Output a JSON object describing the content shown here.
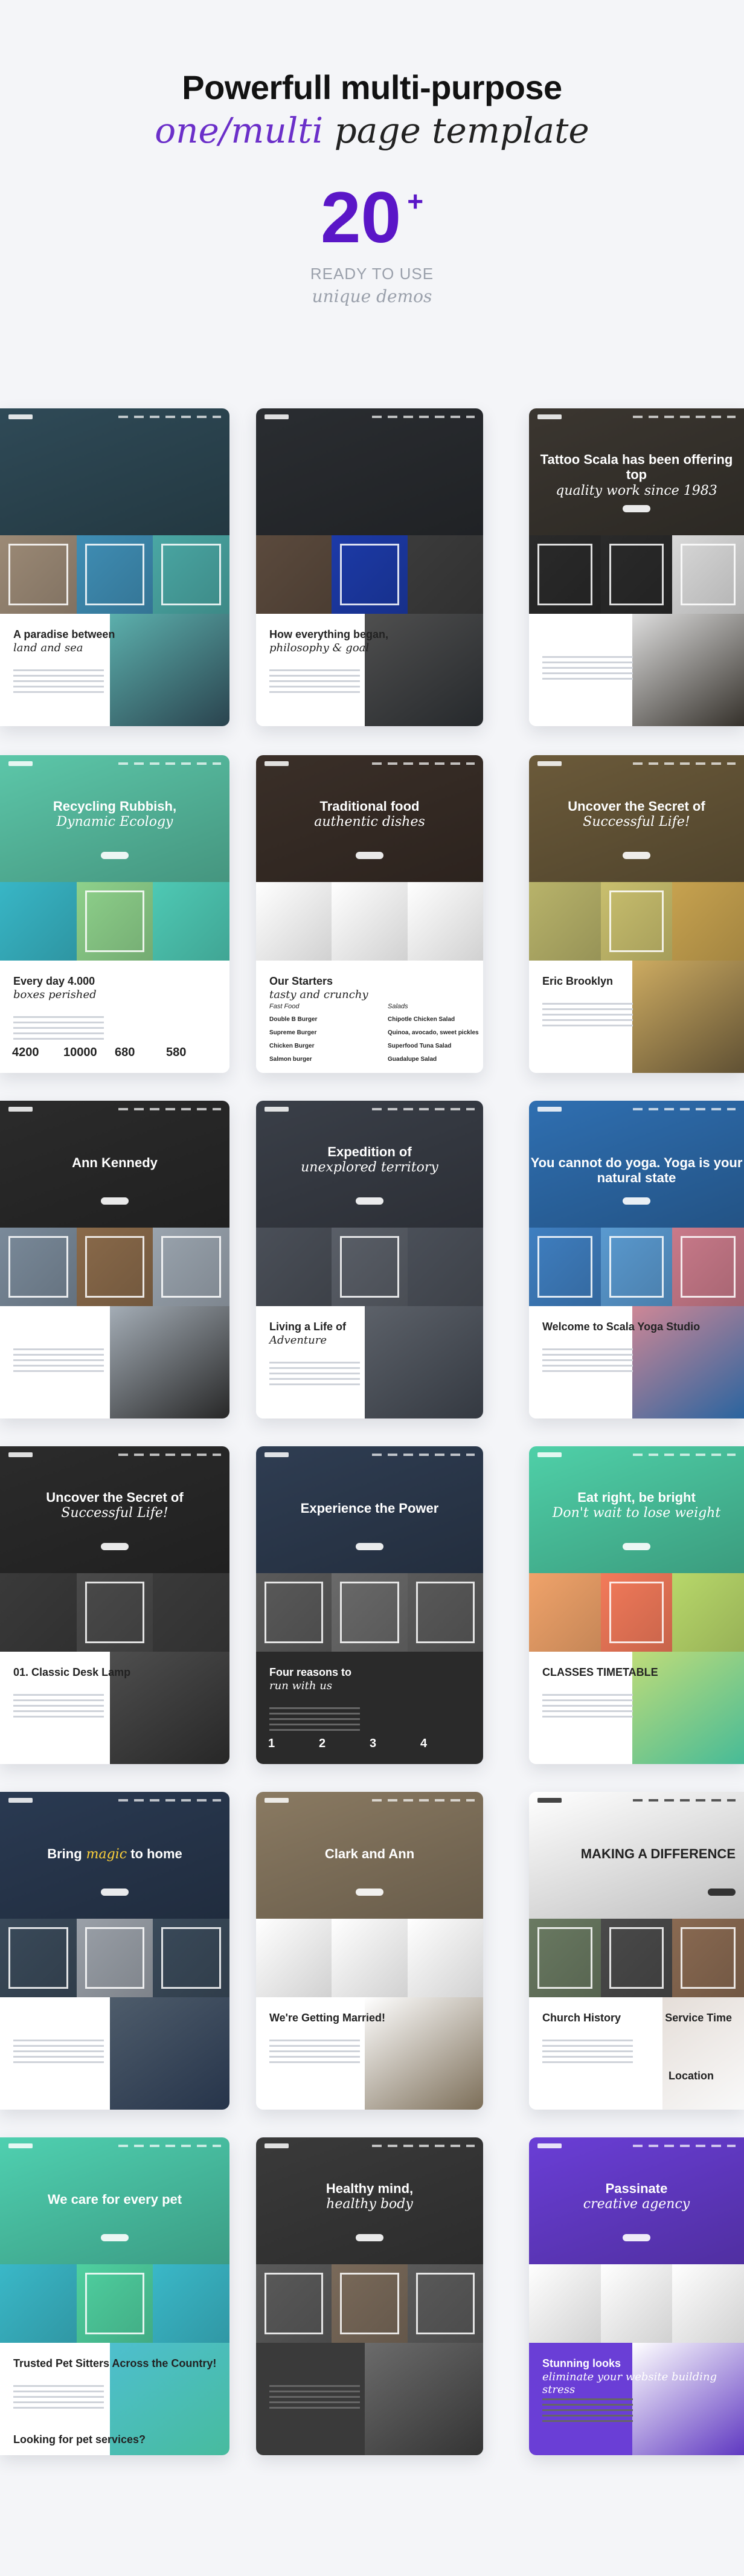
{
  "header": {
    "line1": "Powerfull multi-purpose",
    "line2_accent": "one/multi",
    "line2_rest": " page template",
    "count": "20",
    "count_plus": "+",
    "ready": "READY TO USE",
    "unique": "unique demos"
  },
  "demos": [
    {
      "title": "",
      "bottom_title": "A paradise between",
      "bottom_italic": "land and sea",
      "colors": {
        "top": "#2f4a57",
        "mid1": "#9c8a76",
        "mid2": "#3f8eb5",
        "mid3": "#4aa7a4",
        "bot": "#ffffff"
      }
    },
    {
      "title": "",
      "bottom_title": "How everything began,",
      "bottom_italic": "philosophy & goal",
      "colors": {
        "top": "#2a2d31",
        "mid1": "#5b4a3d",
        "mid2": "#1c3aa8",
        "mid3": "#3b3b3b",
        "bot": "#ffffff"
      }
    },
    {
      "title": "Tattoo Scala has been offering top",
      "title_italic": "quality work since 1983",
      "colors": {
        "top": "#3b3630",
        "mid1": "#2a2a2a",
        "mid2": "#2a2a2a",
        "mid3": "#d9d9d9",
        "bot": "#ffffff"
      }
    },
    {
      "title": "Recycling Rubbish,",
      "title_italic": "Dynamic Ecology",
      "bottom_title": "Every day 4.000",
      "bottom_italic": "boxes perished",
      "stats": [
        "4200",
        "10000",
        "680",
        "580"
      ],
      "colors": {
        "top": "#5cc7a9",
        "mid1": "#38b6c6",
        "mid2": "#8ed18b",
        "mid3": "#4ec9b4",
        "bot": "#ffffff"
      }
    },
    {
      "title": "Traditional food",
      "title_italic": "authentic dishes",
      "bottom_title": "Our Starters",
      "bottom_italic": "tasty and crunchy",
      "menu_left_head": "Fast Food",
      "menu_right_head": "Salads",
      "menu_left": [
        "Double B Burger",
        "Supreme Burger",
        "Chicken Burger",
        "Salmon burger"
      ],
      "menu_right": [
        "Chipotle Chicken Salad",
        "Quinoa, avocado, sweet pickles",
        "Superfood Tuna Salad",
        "Guadalupe Salad"
      ],
      "colors": {
        "top": "#3a2f28",
        "mid1": "#ffffff",
        "mid2": "#ffffff",
        "mid3": "#ffffff",
        "bot": "#ffffff"
      }
    },
    {
      "title": "Uncover the Secret of",
      "title_italic": "Successful Life!",
      "bottom_title": "Eric Brooklyn",
      "colors": {
        "top": "#6b5a3a",
        "mid1": "#b8b36a",
        "mid2": "#c9bf6e",
        "mid3": "#c7a24f",
        "bot": "#ffffff"
      }
    },
    {
      "title": "Ann Kennedy",
      "colors": {
        "top": "#2b2b2b",
        "mid1": "#7a8a9a",
        "mid2": "#8a6a4a",
        "mid3": "#9aa4ae",
        "bot": "#ffffff"
      }
    },
    {
      "title": "Expedition of",
      "title_italic": "unexplored territory",
      "bottom_title": "Living a Life of",
      "bottom_italic": "Adventure",
      "colors": {
        "top": "#3a3f48",
        "mid1": "#4a4f58",
        "mid2": "#5a5f68",
        "mid3": "#4a4f58",
        "bot": "#ffffff"
      }
    },
    {
      "title": "You cannot do yoga. Yoga is your natural state",
      "bottom_title": "Welcome to Scala Yoga Studio",
      "colors": {
        "top": "#2f6fb1",
        "mid1": "#3f7fc1",
        "mid2": "#5a9ad0",
        "mid3": "#c97a8a",
        "bot": "#ffffff"
      }
    },
    {
      "title": "Uncover the Secret of",
      "title_italic": "Successful Life!",
      "bottom_title": "01. Classic Desk Lamp",
      "colors": {
        "top": "#2b2b2b",
        "mid1": "#3a3a3a",
        "mid2": "#4a4a4a",
        "mid3": "#3a3a3a",
        "bot": "#ffffff"
      }
    },
    {
      "title": "Experience the Power",
      "bottom_title": "Four reasons to",
      "bottom_italic": "run with us",
      "stats": [
        "1",
        "2",
        "3",
        "4"
      ],
      "colors": {
        "top": "#2f3d52",
        "mid1": "#5a5a5a",
        "mid2": "#6a6a6a",
        "mid3": "#5a5a5a",
        "bot": "#2a2a2a"
      }
    },
    {
      "title": "Eat right, be bright",
      "title_italic": "Don't wait to lose weight",
      "bottom_title": "CLASSES TIMETABLE",
      "colors": {
        "top": "#4fd0a8",
        "mid1": "#f0a36a",
        "mid2": "#f37a5a",
        "mid3": "#b8d86a",
        "bot": "#ffffff"
      }
    },
    {
      "title": "Bring",
      "title_accent": "magic",
      "title_rest": " to home",
      "colors": {
        "top": "#2a3a52",
        "mid1": "#3a4a5a",
        "mid2": "#9aa0a8",
        "mid3": "#3a4a5a",
        "bot": "#ffffff"
      }
    },
    {
      "title": "Clark and Ann",
      "bottom_title": "We're Getting Married!",
      "colors": {
        "top": "#8a7a62",
        "mid1": "#ffffff",
        "mid2": "#ffffff",
        "mid3": "#ffffff",
        "bot": "#ffffff"
      }
    },
    {
      "title": "MAKING A DIFFERENCE",
      "bottom_title": "Church History",
      "side_title": "Service Time",
      "side_title2": "Location",
      "colors": {
        "top": "#ffffff",
        "mid1": "#6a7a62",
        "mid2": "#4a4a4a",
        "mid3": "#8a6a52",
        "bot": "#ffffff"
      }
    },
    {
      "title": "We care for every pet",
      "bottom_title": "Trusted Pet Sitters Across the Country!",
      "bottom_title2": "Looking for pet services?",
      "colors": {
        "top": "#4fd0b0",
        "mid1": "#3ab8c8",
        "mid2": "#4fd0a0",
        "mid3": "#3ab8c8",
        "bot": "#ffffff"
      }
    },
    {
      "title": "Healthy mind,",
      "title_italic": "healthy body",
      "colors": {
        "top": "#3a3a3a",
        "mid1": "#5a5a5a",
        "mid2": "#7a6a5a",
        "mid3": "#5a5a5a",
        "bot": "#3a3a3a"
      }
    },
    {
      "title": "Passinate",
      "title_italic": "creative agency",
      "bottom_title": "Stunning looks",
      "bottom_italic": "eliminate your website building stress",
      "colors": {
        "top": "#6a3ed6",
        "mid1": "#ffffff",
        "mid2": "#ffffff",
        "mid3": "#ffffff",
        "bot": "#6a3ed6"
      }
    }
  ]
}
